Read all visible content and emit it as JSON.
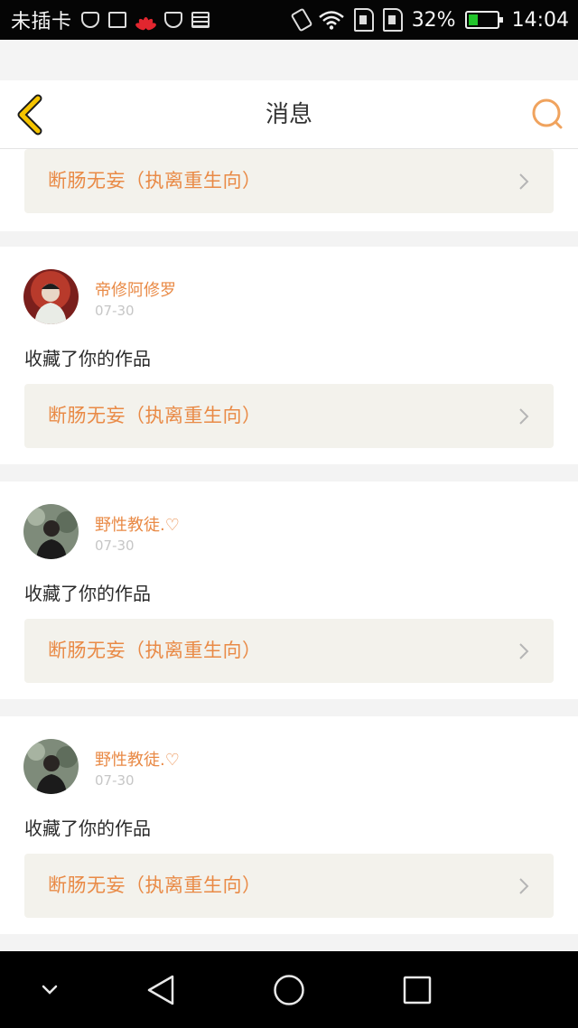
{
  "status_bar": {
    "carrier": "未插卡",
    "battery_percent": "32%",
    "battery_level": 0.32,
    "time": "14:04",
    "icons": [
      "shield-plus-icon",
      "photo-icon",
      "huawei-icon",
      "vpn-shield-icon",
      "list-icon",
      "vibrate-icon",
      "wifi-icon",
      "sim-card-icon",
      "sim-card-icon",
      "battery-charging-icon"
    ]
  },
  "header": {
    "title": "消息",
    "back_icon": "chevron-left-icon",
    "search_icon": "search-icon"
  },
  "feed": {
    "partial_item": {
      "work_title": "断肠无妄（执离重生向）"
    },
    "items": [
      {
        "username": "帝修阿修罗",
        "date": "07-30",
        "action": "收藏了你的作品",
        "work_title": "断肠无妄（执离重生向）"
      },
      {
        "username": "野性教徒.♡",
        "date": "07-30",
        "action": "收藏了你的作品",
        "work_title": "断肠无妄（执离重生向）"
      },
      {
        "username": "野性教徒.♡",
        "date": "07-30",
        "action": "收藏了你的作品",
        "work_title": "断肠无妄（执离重生向）"
      }
    ]
  },
  "nav_bar": {
    "icons": [
      "hide-keyboard-icon",
      "back-triangle-icon",
      "home-circle-icon",
      "recents-square-icon"
    ]
  },
  "colors": {
    "accent": "#e98a46",
    "back_icon": "#f5c400",
    "work_bg": "#f3f2ec",
    "status_bar_bg": "#050505",
    "nav_bar_bg": "#000000"
  }
}
